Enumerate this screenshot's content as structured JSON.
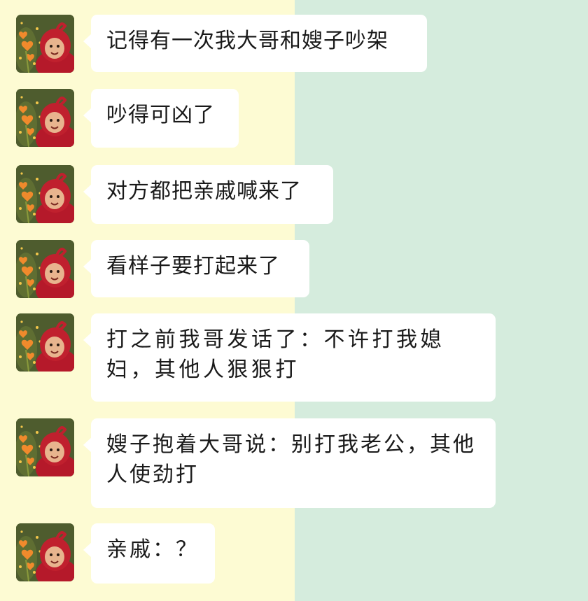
{
  "chat": {
    "messages": [
      {
        "sender_avatar": "teletubby-po-avatar-icon",
        "text": "记得有一次我大哥和嫂子吵架"
      },
      {
        "sender_avatar": "teletubby-po-avatar-icon",
        "text": "吵得可凶了"
      },
      {
        "sender_avatar": "teletubby-po-avatar-icon",
        "text": "对方都把亲戚喊来了"
      },
      {
        "sender_avatar": "teletubby-po-avatar-icon",
        "text": "看样子要打起来了"
      },
      {
        "sender_avatar": "teletubby-po-avatar-icon",
        "text": "打之前我哥发话了：不许打我媳妇，其他人狠狠打"
      },
      {
        "sender_avatar": "teletubby-po-avatar-icon",
        "text": "嫂子抱着大哥说：别打我老公，其他人使劲打"
      },
      {
        "sender_avatar": "teletubby-po-avatar-icon",
        "text": "亲戚：？"
      }
    ]
  },
  "colors": {
    "left_background": "#fdfbd3",
    "right_background": "#d5ecdd",
    "bubble": "#ffffff",
    "text": "#1a1a1a"
  }
}
